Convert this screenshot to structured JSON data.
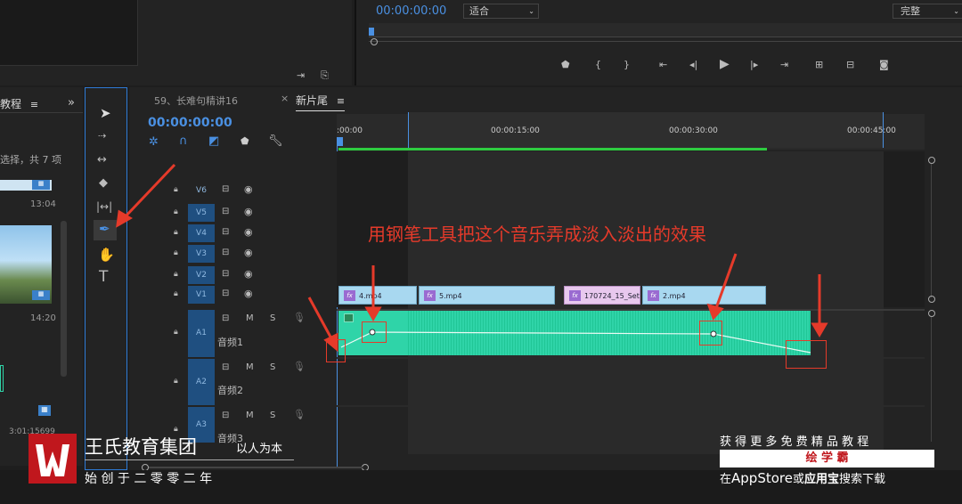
{
  "program": {
    "timecode": "00:00:00:00",
    "zoom_select": "适合",
    "quality_select": "完整"
  },
  "project": {
    "tab_label": "教程",
    "selection_info": "选择，共 7 项",
    "item1_duration": "13:04",
    "item2_duration": "14:20",
    "item3_duration": "3:01:15699"
  },
  "timeline": {
    "tab_inactive": "59、长难句精讲16",
    "tab_active": "新片尾",
    "timecode": "00:00:00:00",
    "ruler": [
      ":00:00",
      "00:00:15:00",
      "00:00:30:00",
      "00:00:45:00"
    ],
    "video_tracks": [
      "V6",
      "V5",
      "V4",
      "V3",
      "V2",
      "V1"
    ],
    "audio_tracks": [
      {
        "id": "A1",
        "name": "音频1"
      },
      {
        "id": "A2",
        "name": "音频2"
      },
      {
        "id": "A3",
        "name": "音频3"
      }
    ],
    "clips": [
      "4.mp4",
      "5.mp4",
      "170724_15_Set",
      "2.mp4"
    ],
    "mute_label": "M",
    "solo_label": "S"
  },
  "annotation": "用钢笔工具把这个音乐弄成淡入淡出的效果",
  "watermark": {
    "company": "王氏教育集团",
    "motto": "以人为本",
    "founded": "始 创 于 二 零 零 二 年",
    "promo_line1": "获 得 更 多 免 费 精 品 教 程",
    "promo_brand": "绘 学 霸",
    "promo_line3_a": "在",
    "promo_line3_b": "AppStore",
    "promo_line3_c": "或",
    "promo_line3_d": "应用宝",
    "promo_line3_e": "搜索下载"
  },
  "colors": {
    "accent": "#4a90e2",
    "audio_clip": "#2fd4a8",
    "annotation": "#e53a2a"
  }
}
